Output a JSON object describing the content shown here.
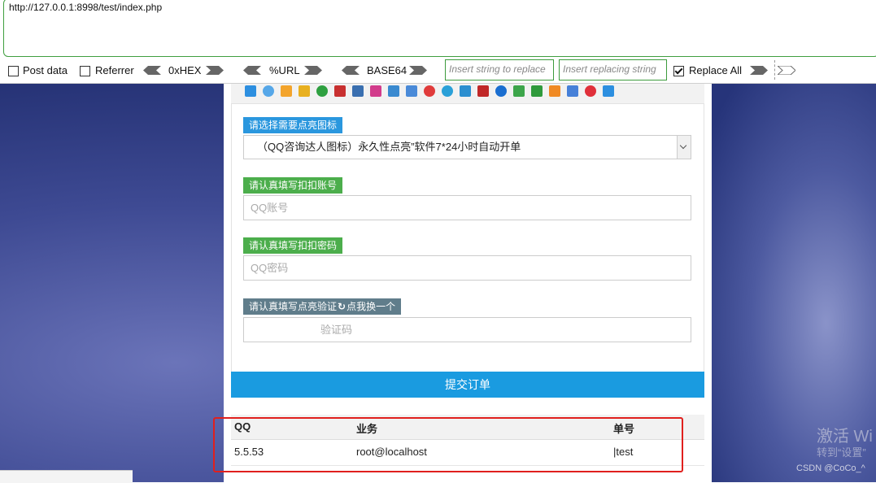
{
  "url_bar": {
    "url": "http://127.0.0.1:8998/test/index.php"
  },
  "toolbar": {
    "post_data": "Post data",
    "referrer": "Referrer",
    "hex": "0xHEX",
    "url": "%URL",
    "base64": "BASE64",
    "insert_placeholder": "Insert string to replace",
    "replacing_placeholder": "Insert replacing string",
    "replace_all": "Replace All",
    "post_data_checked": false,
    "referrer_checked": false,
    "replace_all_checked": true
  },
  "form": {
    "icon_label": "请选择需要点亮图标",
    "icon_selected": "（QQ咨询达人图标）永久性点亮”软件7*24小时自动开单",
    "account_label": "请认真填写扣扣账号",
    "account_placeholder": "QQ账号",
    "password_label": "请认真填写扣扣密码",
    "password_placeholder": "QQ密码",
    "captcha_label_prefix": "请认真填写点亮验证",
    "captcha_refresh": "点我换一个",
    "captcha_placeholder": "验证码",
    "submit": "提交订单"
  },
  "table": {
    "headers": [
      "QQ",
      "业务",
      "单号"
    ],
    "rows": [
      [
        "5.5.53",
        "root@localhost",
        "|test"
      ]
    ]
  },
  "watermark": {
    "activate": "激活 Wi",
    "goto": "转到“设置”",
    "csdn": "CSDN @CoCo_^"
  },
  "colors": {
    "label_blue": "#2a97de",
    "label_green": "#4cae4c",
    "label_gray": "#607d8b",
    "submit": "#1a9be0",
    "highlight": "#e0201e"
  }
}
